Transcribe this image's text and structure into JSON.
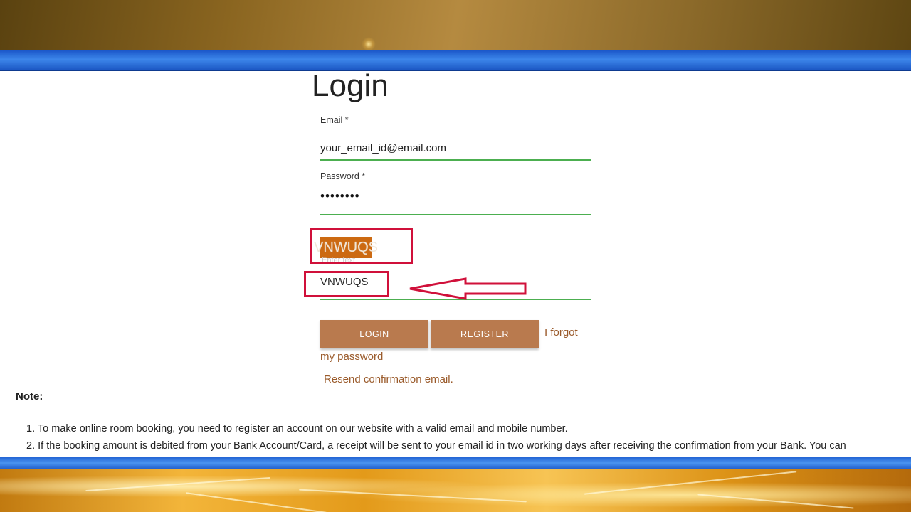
{
  "page": {
    "title": "Login"
  },
  "form": {
    "email_label": "Email *",
    "email_value": "your_email_id@email.com",
    "password_label": "Password *",
    "password_mask": "••••••••",
    "captcha_code": "VNWUQS",
    "captcha_placeholder": "Enter text",
    "captcha_value": "VNWUQS",
    "login_button": "LOGIN",
    "register_button": "REGISTER",
    "forgot_link_line1": "I forgot",
    "forgot_link_line2": "my password",
    "resend_link": "Resend confirmation email."
  },
  "note": {
    "title": "Note:",
    "items": [
      "1. To make online room booking, you need to register an account on our website with a valid email and mobile number.",
      "2. If the booking amount is debited from your Bank Account/Card, a receipt will be sent to your email id in two working days after receiving the confirmation from your Bank. You can"
    ]
  },
  "colors": {
    "accent_button": "#b97a4e",
    "input_underline": "#4caf50",
    "captcha_bg": "#cc6a12",
    "annotation": "#d0103a",
    "link": "#9a5a2a",
    "band": "#2f78e0"
  },
  "icons": {
    "annotation_arrow": "left-arrow-icon"
  }
}
